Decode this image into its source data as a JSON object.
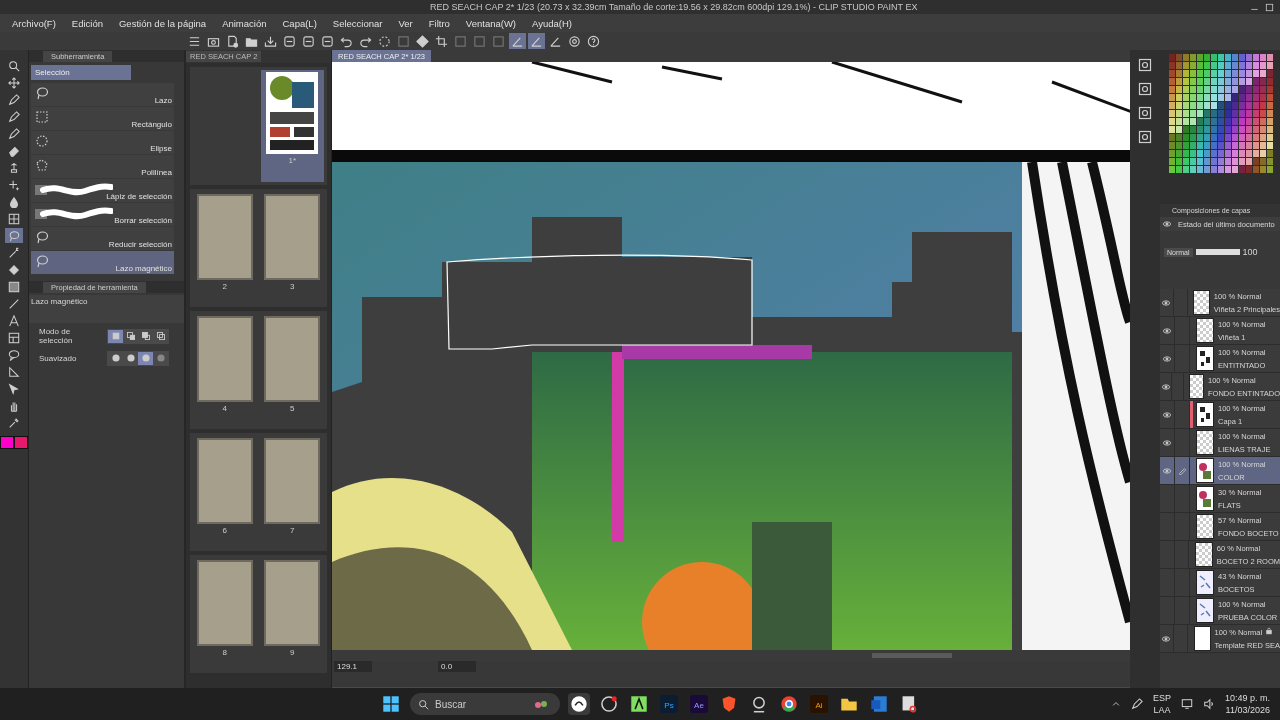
{
  "window": {
    "title": "RED SEACH CAP 2* 1/23 (20.73 x 32.39cm Tamaño de corte:19.56 x 29.82cm 600dpi 129.1%)  - CLIP STUDIO PAINT EX"
  },
  "menu": [
    "Archivo(F)",
    "Edición",
    "Gestión de la página",
    "Animación",
    "Capa(L)",
    "Seleccionar",
    "Ver",
    "Filtro",
    "Ventana(W)",
    "Ayuda(H)"
  ],
  "toolbar": [
    {
      "kind": "menu",
      "selected": false
    },
    {
      "kind": "camera",
      "selected": false
    },
    {
      "kind": "new",
      "selected": false
    },
    {
      "kind": "open",
      "selected": false
    },
    {
      "kind": "save",
      "selected": false
    },
    {
      "kind": "export",
      "selected": false
    },
    {
      "kind": "export",
      "selected": false
    },
    {
      "kind": "export",
      "selected": false
    },
    {
      "kind": "undo",
      "selected": false
    },
    {
      "kind": "redo",
      "selected": false
    },
    {
      "kind": "spinner",
      "selected": false
    },
    {
      "kind": "clear",
      "selected": false
    },
    {
      "kind": "fill",
      "selected": false
    },
    {
      "kind": "crop",
      "selected": false
    },
    {
      "kind": "clear",
      "selected": false
    },
    {
      "kind": "clear",
      "selected": false
    },
    {
      "kind": "clear",
      "selected": false
    },
    {
      "kind": "ruler",
      "selected": true
    },
    {
      "kind": "ruler",
      "selected": true
    },
    {
      "kind": "ruler",
      "selected": false
    },
    {
      "kind": "gear",
      "selected": false
    },
    {
      "kind": "help",
      "selected": false
    }
  ],
  "tools": [
    {
      "kind": "zoom",
      "selected": false
    },
    {
      "kind": "move",
      "selected": false
    },
    {
      "kind": "pen",
      "selected": false
    },
    {
      "kind": "pen",
      "selected": false
    },
    {
      "kind": "pen",
      "selected": false
    },
    {
      "kind": "eraser",
      "selected": false
    },
    {
      "kind": "stamp",
      "selected": false
    },
    {
      "kind": "spark",
      "selected": false
    },
    {
      "kind": "drop",
      "selected": false
    },
    {
      "kind": "grid",
      "selected": false
    },
    {
      "kind": "lasso",
      "selected": true
    },
    {
      "kind": "wand",
      "selected": false
    },
    {
      "kind": "bucket",
      "selected": false
    },
    {
      "kind": "gradient",
      "selected": false
    },
    {
      "kind": "line",
      "selected": false
    },
    {
      "kind": "text",
      "selected": false
    },
    {
      "kind": "frame",
      "selected": false
    },
    {
      "kind": "balloon",
      "selected": false
    },
    {
      "kind": "ruler",
      "selected": false
    },
    {
      "kind": "pointer",
      "selected": false
    },
    {
      "kind": "hand",
      "selected": false
    },
    {
      "kind": "dropper",
      "selected": false
    }
  ],
  "colors": [
    {
      "color": "#ff00cc"
    },
    {
      "color": "#e8186c"
    }
  ],
  "subtool": {
    "title": "Subherramienta",
    "group": "Selección",
    "items": [
      {
        "label": "Lazo",
        "kind": "lasso",
        "selected": false
      },
      {
        "label": "Rectángulo",
        "kind": "rect",
        "selected": false
      },
      {
        "label": "Elipse",
        "kind": "ellipse",
        "selected": false
      },
      {
        "label": "Polilínea",
        "kind": "polyline",
        "selected": false
      },
      {
        "label": "Lápiz de selección",
        "kind": "brush",
        "selected": false
      },
      {
        "label": "Borrar selección",
        "kind": "brush",
        "selected": false
      },
      {
        "label": "Reducir selección",
        "kind": "lasso",
        "selected": false
      },
      {
        "label": "Lazo magnético",
        "kind": "lasso",
        "selected": true
      }
    ]
  },
  "property": {
    "title": "Propiedad de herramienta",
    "tool": "Lazo magnético",
    "rows": [
      {
        "label": "Modo de selección",
        "options": [
          {
            "kind": "square",
            "selected": true
          },
          {
            "kind": "add",
            "selected": false
          },
          {
            "kind": "sub",
            "selected": false
          },
          {
            "kind": "intersect",
            "selected": false
          }
        ]
      },
      {
        "label": "Suavizado",
        "options": [
          {
            "kind": "dot",
            "selected": false
          },
          {
            "kind": "dot",
            "selected": false
          },
          {
            "kind": "dot",
            "selected": true
          },
          {
            "kind": "soft",
            "selected": false
          }
        ]
      }
    ]
  },
  "page_manager": {
    "tab": "RED SEACH CAP 2",
    "pages": [
      {
        "label": "1*",
        "kind": "art",
        "selected": true
      },
      {
        "label": "2",
        "kind": "blank",
        "selected": false
      },
      {
        "label": "3",
        "kind": "blank",
        "selected": false
      },
      {
        "label": "4",
        "kind": "blank",
        "selected": false
      },
      {
        "label": "5",
        "kind": "blank",
        "selected": false
      },
      {
        "label": "6",
        "kind": "blank",
        "selected": false
      },
      {
        "label": "7",
        "kind": "blank",
        "selected": false
      },
      {
        "label": "8",
        "kind": "blank",
        "selected": false
      },
      {
        "label": "9",
        "kind": "blank",
        "selected": false
      }
    ]
  },
  "canvas": {
    "tab": "RED SEACH CAP 2* 1/23",
    "zoom": "129.1",
    "angle": "0.0"
  },
  "layer_comps": {
    "title": "Composiciones de capas",
    "state": "Estado del último documento"
  },
  "layer_panel": {
    "blend": "Normal",
    "opacity": "100",
    "level": 1.0
  },
  "layers": [
    {
      "blend": "100 % Normal",
      "name": "Viñeta 2 Principales",
      "kind": "blank",
      "visible": true,
      "selected": false,
      "editing": false,
      "locked": false
    },
    {
      "blend": "100 % Normal",
      "name": "Viñeta 1",
      "kind": "blank",
      "visible": true,
      "selected": false,
      "editing": false,
      "locked": false
    },
    {
      "blend": "100 % Normal",
      "name": "ENTITNTADO",
      "kind": "ink",
      "visible": true,
      "selected": false,
      "editing": false,
      "locked": false
    },
    {
      "blend": "100 % Normal",
      "name": "FONDO ENTINTADO",
      "kind": "blank",
      "visible": true,
      "selected": false,
      "editing": false,
      "locked": false
    },
    {
      "blend": "100 % Normal",
      "name": "Capa 1",
      "kind": "ink",
      "visible": true,
      "selected": false,
      "editing": false,
      "locked": false,
      "color": "#e06070"
    },
    {
      "blend": "100 % Normal",
      "name": "LIENAS TRAJE",
      "kind": "blank",
      "visible": true,
      "selected": false,
      "editing": false,
      "locked": false
    },
    {
      "blend": "100 % Normal",
      "name": "COLOR",
      "kind": "color",
      "visible": true,
      "selected": true,
      "editing": true,
      "locked": false
    },
    {
      "blend": "30 % Normal",
      "name": "FLATS",
      "kind": "color",
      "visible": false,
      "selected": false,
      "editing": false,
      "locked": false
    },
    {
      "blend": "57 % Normal",
      "name": "FONDO BOCETO",
      "kind": "blank",
      "visible": false,
      "selected": false,
      "editing": false,
      "locked": false
    },
    {
      "blend": "60 % Normal",
      "name": "BOCETO 2 ROOM",
      "kind": "blank",
      "visible": false,
      "selected": false,
      "editing": false,
      "locked": false
    },
    {
      "blend": "43 % Normal",
      "name": "BOCETOS",
      "kind": "sketch",
      "visible": false,
      "selected": false,
      "editing": false,
      "locked": false
    },
    {
      "blend": "100 % Normal",
      "name": "PRUEBA COLOR",
      "kind": "sketch",
      "visible": false,
      "selected": false,
      "editing": false,
      "locked": false
    },
    {
      "blend": "100 % Normal",
      "name": "Template RED SEA",
      "kind": "white",
      "visible": true,
      "selected": false,
      "editing": false,
      "locked": true
    }
  ],
  "taskbar": {
    "search": "Buscar",
    "apps": [
      {
        "kind": "csp",
        "active": true
      },
      {
        "kind": "obs",
        "active": false
      },
      {
        "kind": "a",
        "active": false
      },
      {
        "kind": "ps",
        "label": "Ps",
        "active": false
      },
      {
        "kind": "ae",
        "label": "Ae",
        "active": false
      },
      {
        "kind": "brave",
        "active": false
      },
      {
        "kind": "disc",
        "active": false
      },
      {
        "kind": "chrome",
        "active": false
      },
      {
        "kind": "ai",
        "label": "Ai",
        "active": false
      },
      {
        "kind": "folder",
        "active": false
      },
      {
        "kind": "word",
        "active": false
      },
      {
        "kind": "snip",
        "active": false
      }
    ],
    "language": "ESP",
    "layout": "LAA",
    "time": "10:49 p. m.",
    "date": "11/03/2026"
  }
}
